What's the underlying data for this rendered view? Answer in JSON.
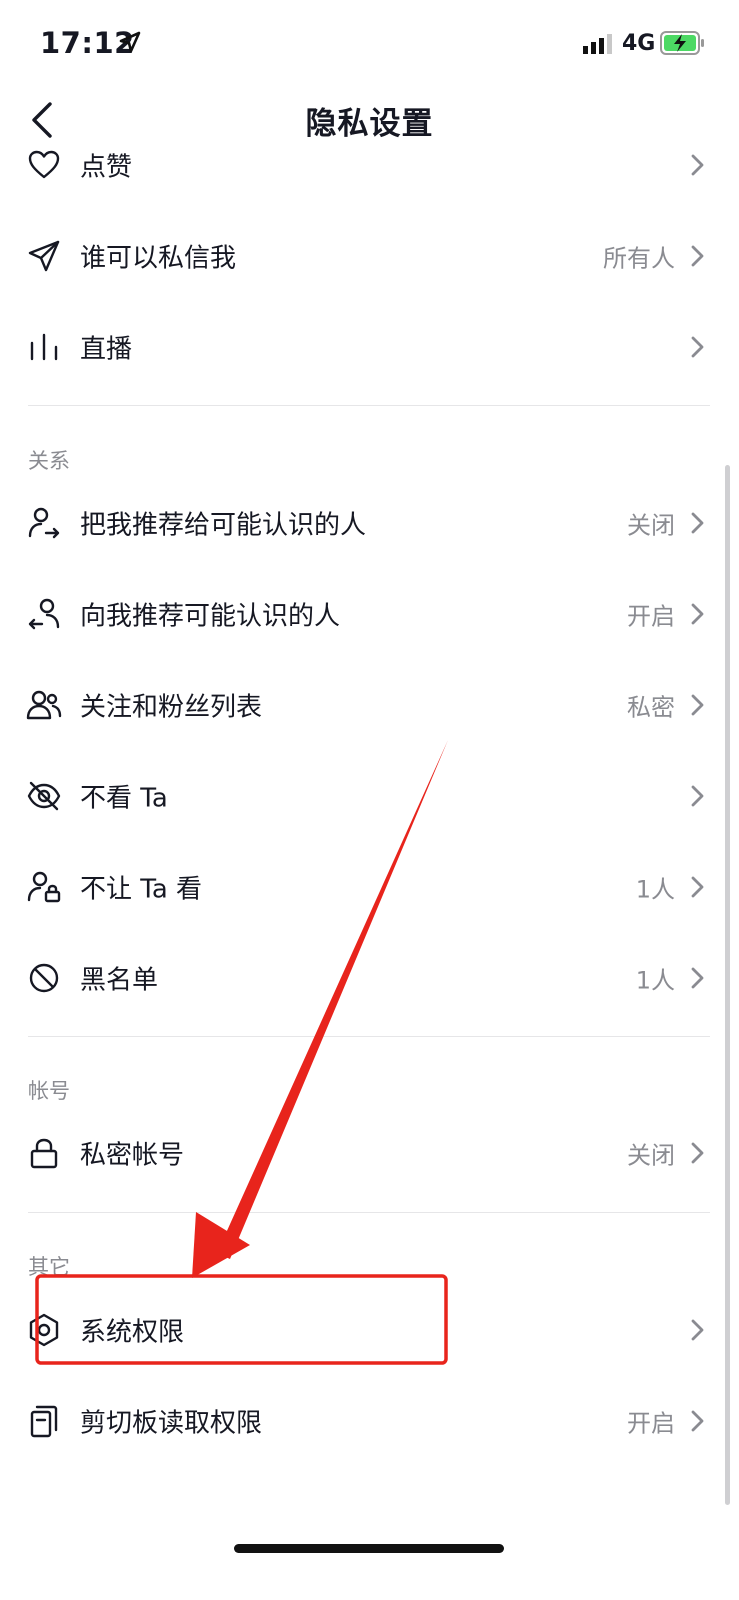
{
  "status_bar": {
    "time": "17:12",
    "network": "4G"
  },
  "header": {
    "title": "隐私设置"
  },
  "sections": {
    "relations": "关系",
    "account": "帐号",
    "other": "其它"
  },
  "rows": {
    "like": {
      "label": "点赞",
      "value": ""
    },
    "who_dm": {
      "label": "谁可以私信我",
      "value": "所有人"
    },
    "live": {
      "label": "直播",
      "value": ""
    },
    "recommend_me": {
      "label": "把我推荐给可能认识的人",
      "value": "关闭"
    },
    "recommend_to_me": {
      "label": "向我推荐可能认识的人",
      "value": "开启"
    },
    "follow_list": {
      "label": "关注和粉丝列表",
      "value": "私密"
    },
    "dont_see": {
      "label": "不看 Ta",
      "value": ""
    },
    "dont_let_see": {
      "label": "不让 Ta 看",
      "value": "1人"
    },
    "blacklist": {
      "label": "黑名单",
      "value": "1人"
    },
    "private_account": {
      "label": "私密帐号",
      "value": "关闭"
    },
    "system_permission": {
      "label": "系统权限",
      "value": ""
    },
    "clipboard": {
      "label": "剪切板读取权限",
      "value": "开启"
    }
  },
  "annotation": {
    "color": "#e8241c"
  },
  "icons": {
    "like": "heart-icon",
    "who_dm": "send-icon",
    "live": "live-bars-icon",
    "recommend_me": "user-share-icon",
    "recommend_to_me": "user-receive-icon",
    "follow_list": "users-icon",
    "dont_see": "eye-off-icon",
    "dont_let_see": "user-lock-icon",
    "blacklist": "block-icon",
    "private_account": "lock-icon",
    "system_permission": "hexagon-settings-icon",
    "clipboard": "clipboard-icon"
  }
}
